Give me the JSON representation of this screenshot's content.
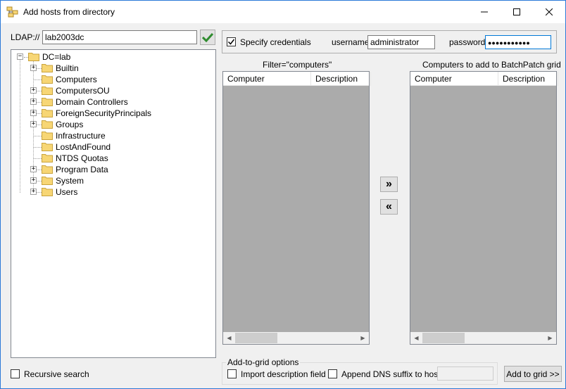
{
  "window": {
    "title": "Add hosts from directory",
    "controls": {
      "minimize": "minimize",
      "maximize": "maximize",
      "close": "close"
    }
  },
  "ldap": {
    "label": "LDAP://",
    "value": "lab2003dc"
  },
  "credentials": {
    "checkbox_label": "Specify credentials",
    "checked": true,
    "username_label": "username:",
    "username_value": "administrator",
    "password_label": "password:",
    "password_value": "●●●●●●●●●●●"
  },
  "tree": {
    "root": "DC=lab",
    "items": [
      {
        "label": "Builtin",
        "expandable": true
      },
      {
        "label": "Computers",
        "expandable": false
      },
      {
        "label": "ComputersOU",
        "expandable": true
      },
      {
        "label": "Domain Controllers",
        "expandable": true
      },
      {
        "label": "ForeignSecurityPrincipals",
        "expandable": true
      },
      {
        "label": "Groups",
        "expandable": true
      },
      {
        "label": "Infrastructure",
        "expandable": false
      },
      {
        "label": "LostAndFound",
        "expandable": false
      },
      {
        "label": "NTDS Quotas",
        "expandable": false
      },
      {
        "label": "Program Data",
        "expandable": true
      },
      {
        "label": "System",
        "expandable": true
      },
      {
        "label": "Users",
        "expandable": true
      }
    ]
  },
  "filter_list": {
    "caption": "Filter=\"computers\"",
    "columns": [
      "Computer",
      "Description"
    ]
  },
  "target_list": {
    "caption": "Computers to add to BatchPatch grid",
    "columns": [
      "Computer",
      "Description"
    ]
  },
  "transfer": {
    "add_all": "»",
    "remove_all": "«"
  },
  "options": {
    "group_label": "Add-to-grid options",
    "import_description": "Import description field",
    "append_dns": "Append DNS suffix to hosts:",
    "dns_value": ""
  },
  "recursive_search": "Recursive search",
  "add_to_grid_button": "Add to grid >>",
  "colors": {
    "accent": "#2b79d8",
    "list_bg": "#ababab",
    "folder": "#f7d675",
    "check_green": "#2e8b2e"
  }
}
